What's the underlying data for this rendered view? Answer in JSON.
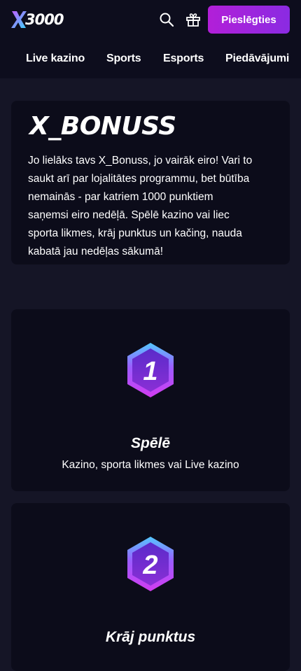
{
  "header": {
    "logo_text": "3000",
    "login_label": "Pieslēgties",
    "icons": [
      "search-icon",
      "gift-icon"
    ]
  },
  "nav": {
    "items": [
      "Live kazino",
      "Sports",
      "Esports",
      "Piedāvājumi"
    ]
  },
  "intro": {
    "title": "X_BONUSS",
    "lines": [
      "Jo lielāks tavs X_Bonuss, jo vairāk eiro! Vari to",
      "saukt arī par lojalitātes programmu, bet būtība",
      "nemainās - par katriem 1000 punktiem",
      "saņemsi eiro nedēļā. Spēlē kazino vai liec",
      "sporta likmes, krāj punktus un kačing, nauda",
      "kabatā jau nedēļas sākumā!"
    ]
  },
  "steps": [
    {
      "number": "1",
      "title": "Spēlē",
      "desc": "Kazino, sporta likmes vai Live kazino"
    },
    {
      "number": "2",
      "title": "Krāj punktus",
      "desc": ""
    }
  ],
  "colors": {
    "page_bg": "#151526",
    "header_bg": "#0d0d1d",
    "card_bg": "#0c0c1a",
    "accent": "#b21fd8",
    "logo_x_start": "#9b5cff",
    "logo_x_end": "#3fd0ff"
  }
}
